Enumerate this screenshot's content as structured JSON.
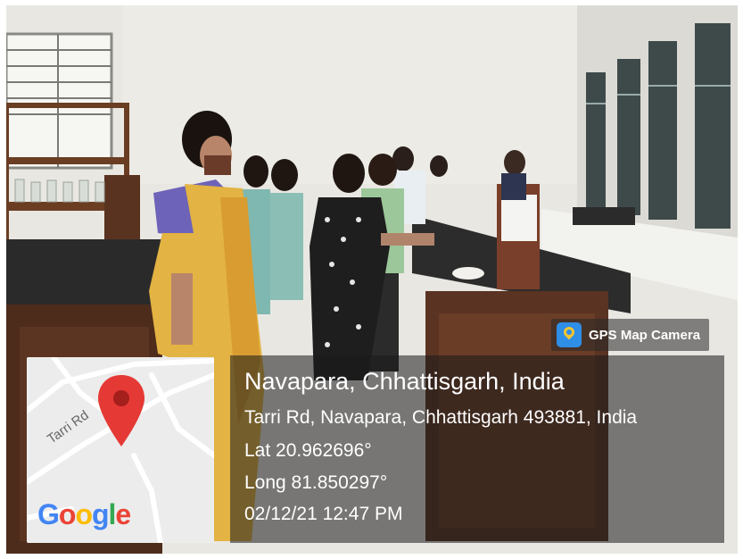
{
  "badge": {
    "label": "GPS Map Camera",
    "icon": "map-pin-icon"
  },
  "location": {
    "title": "Navapara, Chhattisgarh, India",
    "address": "Tarri Rd, Navapara, Chhattisgarh 493881, India",
    "latitude": "Lat 20.962696°",
    "longitude": "Long 81.850297°",
    "datetime": "02/12/21 12:47 PM"
  },
  "map": {
    "road_label": "Tarri Rd",
    "logo": {
      "letters": [
        "G",
        "o",
        "o",
        "g",
        "l",
        "e"
      ],
      "colors": [
        "#4285F4",
        "#EA4335",
        "#FBBC05",
        "#4285F4",
        "#34A853",
        "#EA4335"
      ]
    },
    "pin_color": "#E53935"
  }
}
